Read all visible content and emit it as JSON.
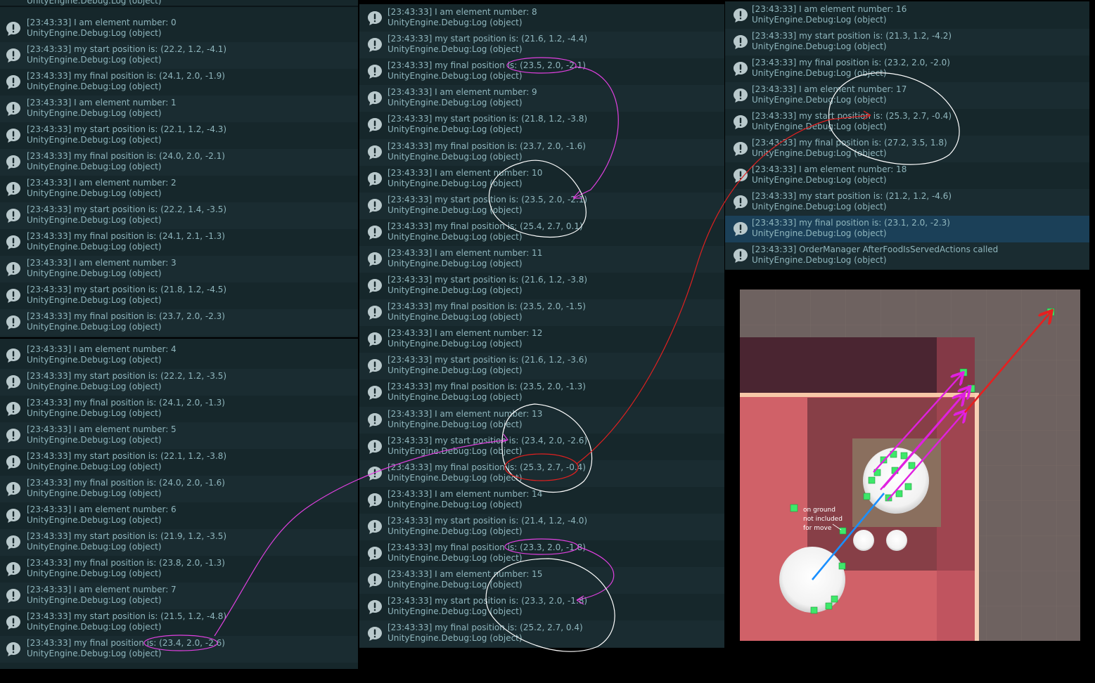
{
  "top_strip": "UnityEngine.Debug:Log (object)",
  "col1_top": [
    {
      "l1": "[23:43:33] I am element number: 0",
      "l2": "UnityEngine.Debug:Log (object)"
    },
    {
      "l1": "[23:43:33] my start position is: (22.2, 1.2, -4.1)",
      "l2": "UnityEngine.Debug:Log (object)"
    },
    {
      "l1": "[23:43:33] my final position is: (24.1, 2.0, -1.9)",
      "l2": "UnityEngine.Debug:Log (object)"
    },
    {
      "l1": "[23:43:33] I am element number: 1",
      "l2": "UnityEngine.Debug:Log (object)"
    },
    {
      "l1": "[23:43:33] my start position is: (22.1, 1.2, -4.3)",
      "l2": "UnityEngine.Debug:Log (object)"
    },
    {
      "l1": "[23:43:33] my final position is: (24.0, 2.0, -2.1)",
      "l2": "UnityEngine.Debug:Log (object)"
    },
    {
      "l1": "[23:43:33] I am element number: 2",
      "l2": "UnityEngine.Debug:Log (object)"
    },
    {
      "l1": "[23:43:33] my start position is: (22.2, 1.4, -3.5)",
      "l2": "UnityEngine.Debug:Log (object)"
    },
    {
      "l1": "[23:43:33] my final position is: (24.1, 2.1, -1.3)",
      "l2": "UnityEngine.Debug:Log (object)"
    },
    {
      "l1": "[23:43:33] I am element number: 3",
      "l2": "UnityEngine.Debug:Log (object)"
    },
    {
      "l1": "[23:43:33] my start position is: (21.8, 1.2, -4.5)",
      "l2": "UnityEngine.Debug:Log (object)"
    },
    {
      "l1": "[23:43:33] my final position is: (23.7, 2.0, -2.3)",
      "l2": "UnityEngine.Debug:Log (object)"
    }
  ],
  "col1_bottom": [
    {
      "l1": "[23:43:33] I am element number: 4",
      "l2": "UnityEngine.Debug:Log (object)"
    },
    {
      "l1": "[23:43:33] my start position is: (22.2, 1.2, -3.5)",
      "l2": "UnityEngine.Debug:Log (object)"
    },
    {
      "l1": "[23:43:33] my final position is: (24.1, 2.0, -1.3)",
      "l2": "UnityEngine.Debug:Log (object)"
    },
    {
      "l1": "[23:43:33] I am element number: 5",
      "l2": "UnityEngine.Debug:Log (object)"
    },
    {
      "l1": "[23:43:33] my start position is: (22.1, 1.2, -3.8)",
      "l2": "UnityEngine.Debug:Log (object)"
    },
    {
      "l1": "[23:43:33] my final position is: (24.0, 2.0, -1.6)",
      "l2": "UnityEngine.Debug:Log (object)"
    },
    {
      "l1": "[23:43:33] I am element number: 6",
      "l2": "UnityEngine.Debug:Log (object)"
    },
    {
      "l1": "[23:43:33] my start position is: (21.9, 1.2, -3.5)",
      "l2": "UnityEngine.Debug:Log (object)"
    },
    {
      "l1": "[23:43:33] my final position is: (23.8, 2.0, -1.3)",
      "l2": "UnityEngine.Debug:Log (object)"
    },
    {
      "l1": "[23:43:33] I am element number: 7",
      "l2": "UnityEngine.Debug:Log (object)"
    },
    {
      "l1": "[23:43:33] my start position is: (21.5, 1.2, -4.8)",
      "l2": "UnityEngine.Debug:Log (object)"
    },
    {
      "l1": "[23:43:33] my final position is: (23.4, 2.0, -2.6)",
      "l2": "UnityEngine.Debug:Log (object)"
    }
  ],
  "col2": [
    {
      "l1": "[23:43:33] I am element number: 8",
      "l2": "UnityEngine.Debug:Log (object)"
    },
    {
      "l1": "[23:43:33] my start position is: (21.6, 1.2, -4.4)",
      "l2": "UnityEngine.Debug:Log (object)"
    },
    {
      "l1": "[23:43:33] my final position is: (23.5, 2.0, -2.1)",
      "l2": "UnityEngine.Debug:Log (object)"
    },
    {
      "l1": "[23:43:33] I am element number: 9",
      "l2": "UnityEngine.Debug:Log (object)"
    },
    {
      "l1": "[23:43:33] my start position is: (21.8, 1.2, -3.8)",
      "l2": "UnityEngine.Debug:Log (object)"
    },
    {
      "l1": "[23:43:33] my final position is: (23.7, 2.0, -1.6)",
      "l2": "UnityEngine.Debug:Log (object)"
    },
    {
      "l1": "[23:43:33] I am element number: 10",
      "l2": "UnityEngine.Debug:Log (object)"
    },
    {
      "l1": "[23:43:33] my start position is: (23.5, 2.0, -2.1)",
      "l2": "UnityEngine.Debug:Log (object)"
    },
    {
      "l1": "[23:43:33] my final position is: (25.4, 2.7, 0.1)",
      "l2": "UnityEngine.Debug:Log (object)"
    },
    {
      "l1": "[23:43:33] I am element number: 11",
      "l2": "UnityEngine.Debug:Log (object)"
    },
    {
      "l1": "[23:43:33] my start position is: (21.6, 1.2, -3.8)",
      "l2": "UnityEngine.Debug:Log (object)"
    },
    {
      "l1": "[23:43:33] my final position is: (23.5, 2.0, -1.5)",
      "l2": "UnityEngine.Debug:Log (object)"
    },
    {
      "l1": "[23:43:33] I am element number: 12",
      "l2": "UnityEngine.Debug:Log (object)"
    },
    {
      "l1": "[23:43:33] my start position is: (21.6, 1.2, -3.6)",
      "l2": "UnityEngine.Debug:Log (object)"
    },
    {
      "l1": "[23:43:33] my final position is: (23.5, 2.0, -1.3)",
      "l2": "UnityEngine.Debug:Log (object)"
    },
    {
      "l1": "[23:43:33] I am element number: 13",
      "l2": "UnityEngine.Debug:Log (object)"
    },
    {
      "l1": "[23:43:33] my start position is: (23.4, 2.0, -2.6)",
      "l2": "UnityEngine.Debug:Log (object)"
    },
    {
      "l1": "[23:43:33] my final position is: (25.3, 2.7, -0.4)",
      "l2": "UnityEngine.Debug:Log (object)"
    },
    {
      "l1": "[23:43:33] I am element number: 14",
      "l2": "UnityEngine.Debug:Log (object)"
    },
    {
      "l1": "[23:43:33] my start position is: (21.4, 1.2, -4.0)",
      "l2": "UnityEngine.Debug:Log (object)"
    },
    {
      "l1": "[23:43:33] my final position is: (23.3, 2.0, -1.8)",
      "l2": "UnityEngine.Debug:Log (object)"
    },
    {
      "l1": "[23:43:33] I am element number: 15",
      "l2": "UnityEngine.Debug:Log (object)"
    },
    {
      "l1": "[23:43:33] my start position is: (23.3, 2.0, -1.8)",
      "l2": "UnityEngine.Debug:Log (object)"
    },
    {
      "l1": "[23:43:33] my final position is: (25.2, 2.7, 0.4)",
      "l2": "UnityEngine.Debug:Log (object)"
    }
  ],
  "col3": [
    {
      "l1": "[23:43:33] I am element number: 16",
      "l2": "UnityEngine.Debug:Log (object)"
    },
    {
      "l1": "[23:43:33] my start position is: (21.3, 1.2, -4.2)",
      "l2": "UnityEngine.Debug:Log (object)"
    },
    {
      "l1": "[23:43:33] my final position is: (23.2, 2.0, -2.0)",
      "l2": "UnityEngine.Debug:Log (object)"
    },
    {
      "l1": "[23:43:33] I am element number: 17",
      "l2": "UnityEngine.Debug:Log (object)"
    },
    {
      "l1": "[23:43:33] my start position is: (25.3, 2.7, -0.4)",
      "l2": "UnityEngine.Debug:Log (object)"
    },
    {
      "l1": "[23:43:33] my final position is: (27.2, 3.5, 1.8)",
      "l2": "UnityEngine.Debug:Log (object)"
    },
    {
      "l1": "[23:43:33] I am element number: 18",
      "l2": "UnityEngine.Debug:Log (object)"
    },
    {
      "l1": "[23:43:33] my start position is: (21.2, 1.2, -4.6)",
      "l2": "UnityEngine.Debug:Log (object)"
    },
    {
      "l1": "[23:43:33] my final position is: (23.1, 2.0, -2.3)",
      "l2": "UnityEngine.Debug:Log (object)"
    },
    {
      "l1": "[23:43:33] OrderManager AfterFoodIsServedActions called",
      "l2": "UnityEngine.Debug:Log (object)"
    }
  ],
  "selected_col3_index": 8,
  "scene": {
    "annotation_lines": [
      "on ground",
      "not included",
      "for move"
    ]
  },
  "colors": {
    "panel_bg": "#16272b",
    "row_alt": "#1a2c31",
    "selected_row": "#1b4058",
    "log_text": "#8fb6bd",
    "icon_fill": "#b9c9cc",
    "magenta_annotation": "#e040e0",
    "red_annotation": "#e02020",
    "white_annotation": "#ffffff",
    "green_marker": "#3ee86a",
    "blue_arrow": "#1a8fff"
  },
  "icons": {
    "log_icon": "speech-bubble-exclamation-icon"
  }
}
